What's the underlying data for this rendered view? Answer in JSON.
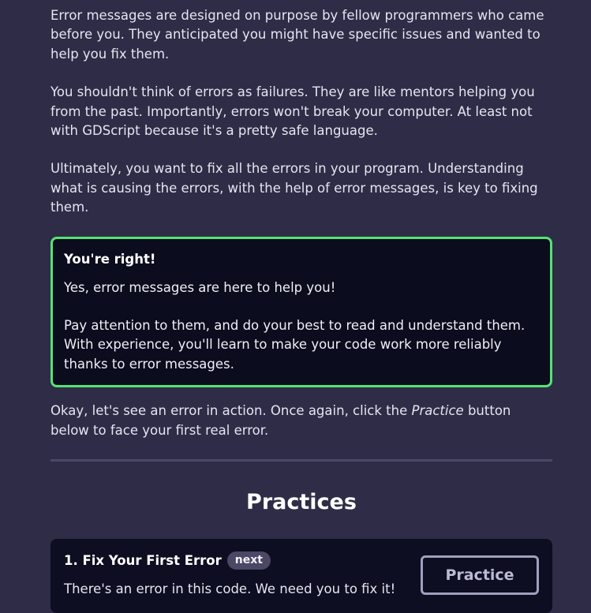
{
  "paragraphs": [
    "Error messages are designed on purpose by fellow programmers who came before you. They anticipated you might have specific issues and wanted to help you fix them.",
    "You shouldn't think of errors as failures. They are like mentors helping you from the past. Importantly, errors won't break your computer. At least not with GDScript because it's a pretty safe language.",
    "Ultimately, you want to fix all the errors in your program. Understanding what is causing the errors, with the help of error messages, is key to fixing them."
  ],
  "callout": {
    "title": "You're right!",
    "line1": "Yes, error messages are here to help you!",
    "line2": "Pay attention to them, and do your best to read and understand them. With experience, you'll learn to make your code work more reliably thanks to error messages.",
    "accent_color": "#53e472"
  },
  "after_callout": {
    "before_em": "Okay, let's see an error in action. Once again, click the ",
    "em": "Practice",
    "after_em": " button below to face your first real error."
  },
  "practices": {
    "heading": "Practices",
    "items": [
      {
        "title": "1. Fix Your First Error",
        "badge": "next",
        "description": "There's an error in this code. We need you to fix it!",
        "button_label": "Practice"
      }
    ]
  }
}
